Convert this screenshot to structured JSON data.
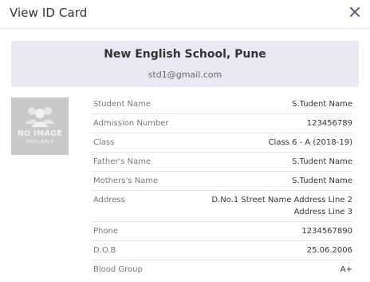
{
  "modal": {
    "title": "View ID Card",
    "close_icon": "close-icon"
  },
  "school": {
    "name": "New English School, Pune",
    "email": "std1@gmail.com"
  },
  "photo": {
    "icon": "user-group-placeholder-icon",
    "line1": "NO IMAGE",
    "line2": "AVAILABLE"
  },
  "details": [
    {
      "label": "Student Name",
      "value": "S.Tudent Name"
    },
    {
      "label": "Admission Number",
      "value": "123456789"
    },
    {
      "label": "Class",
      "value": "Class 6 - A (2018-19)"
    },
    {
      "label": "Father's Name",
      "value": "S.Tudent Name"
    },
    {
      "label": "Mothers's Name",
      "value": "S.Tudent Name"
    },
    {
      "label": "Address",
      "value": "D.No.1 Street Name Address Line 2 Address Line 3"
    },
    {
      "label": "Phone",
      "value": "1234567890"
    },
    {
      "label": "D.O.B",
      "value": "25.06.2006"
    },
    {
      "label": "Blood Group",
      "value": "A+"
    }
  ]
}
